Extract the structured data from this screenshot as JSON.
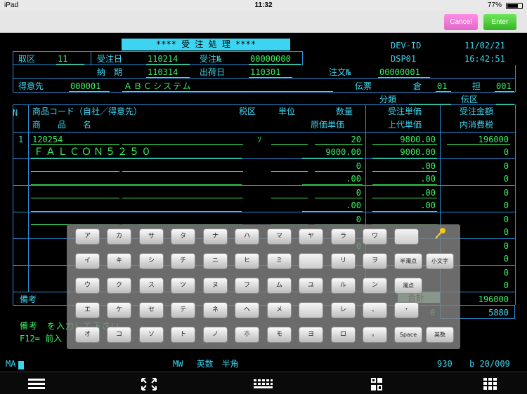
{
  "status_bar": {
    "device": "iPad",
    "time": "11:32",
    "battery": "77%",
    "battery_level": 0.77
  },
  "buttons": {
    "cancel": "Cancel",
    "enter": "Enter"
  },
  "screen": {
    "title": "**** 受 注 処 理 ****",
    "dev_id_label": "DEV-ID",
    "date": "11/02/21",
    "dsp": "DSP01",
    "clock": "16:42:51",
    "row1": {
      "torikubun_label": "取区",
      "torikubun": "11",
      "juchubi_label": "受注日",
      "juchubi": "110214",
      "juchuno_label": "受注№",
      "juchuno": "00000000"
    },
    "row2": {
      "noki_label": "納　期",
      "noki": "110314",
      "shukkabi_label": "出荷日",
      "shukkabi": "110301",
      "chumon_label": "注文№",
      "chumon": "00000001"
    },
    "row3": {
      "tokuisaki_label": "得意先",
      "tokuisaki_code": "000001",
      "tokuisaki_name": "ＡＢＣシステム",
      "denpyo_label": "伝票",
      "kura_label": "倉",
      "kura": "01",
      "tan_label": "担",
      "tan": "001"
    },
    "row4": {
      "bunrui_label": "分類",
      "denku_label": "伝区"
    },
    "header": {
      "n": "N",
      "shohin_code": "商品コード（自社／得意先）",
      "zeiku": "税区",
      "tani": "単位",
      "suryo": "数量",
      "juchu_tanka": "受注単価",
      "juchu_kingaku": "受注金額",
      "shohinmei": "商　　品　　名",
      "genka_tanka": "原価単価",
      "jodai_tanka": "上代単価",
      "uchi_shohizei": "内消費税"
    },
    "lines": [
      {
        "no": "1",
        "code": "120254",
        "zei": "ｿ",
        "qty": "20",
        "price": "9800.00",
        "amount": "196000",
        "name": "ＦＡＬＣＯＮ５２５０",
        "cost": "9000.00",
        "retail": "9000.00",
        "tax": "0"
      },
      {
        "qty": "0",
        "price": ".00",
        "amount": "0",
        "cost": ".00",
        "retail": ".00",
        "tax": "0"
      },
      {
        "qty": "0",
        "price": ".00",
        "amount": "0",
        "cost": ".00",
        "retail": ".00",
        "tax": "0"
      },
      {
        "qty": "0",
        "amount": "0",
        "tax": "0"
      },
      {
        "qty": "0",
        "amount": "0",
        "tax": "0"
      },
      {
        "amount": "0",
        "tax": "0"
      }
    ],
    "biko_label": "備考",
    "gokei_label": "合計",
    "gokei": "196000",
    "tax_total": "5880",
    "tax_partial": "0",
    "message_line1": "備考　を入力して下さい",
    "message_line2": "F12= 前入",
    "status_left": "MA",
    "status_mode": "MW　 英数　半角",
    "status_code": "930",
    "status_pos": "b 20/009"
  },
  "keyboard": {
    "rows": [
      [
        "ア",
        "カ",
        "サ",
        "タ",
        "ナ",
        "ハ",
        "マ",
        "ヤ",
        "ラ",
        "ワ",
        ""
      ],
      [
        "イ",
        "キ",
        "シ",
        "チ",
        "ニ",
        "ヒ",
        "ミ",
        "",
        "リ",
        "ヲ",
        "半濁点",
        "小文字"
      ],
      [
        "ウ",
        "ク",
        "ス",
        "ツ",
        "ヌ",
        "フ",
        "ム",
        "ユ",
        "ル",
        "ン",
        "濁点"
      ],
      [
        "エ",
        "ケ",
        "セ",
        "テ",
        "ネ",
        "ヘ",
        "メ",
        "",
        "レ",
        "、",
        "・"
      ],
      [
        "オ",
        "コ",
        "ソ",
        "ト",
        "ノ",
        "ホ",
        "モ",
        "ヨ",
        "ロ",
        "。",
        "Space",
        "英数"
      ]
    ]
  },
  "footer_icons": [
    "menu-icon",
    "fullscreen-icon",
    "keyboard-icon",
    "conversion-icon",
    "numpad-icon"
  ]
}
